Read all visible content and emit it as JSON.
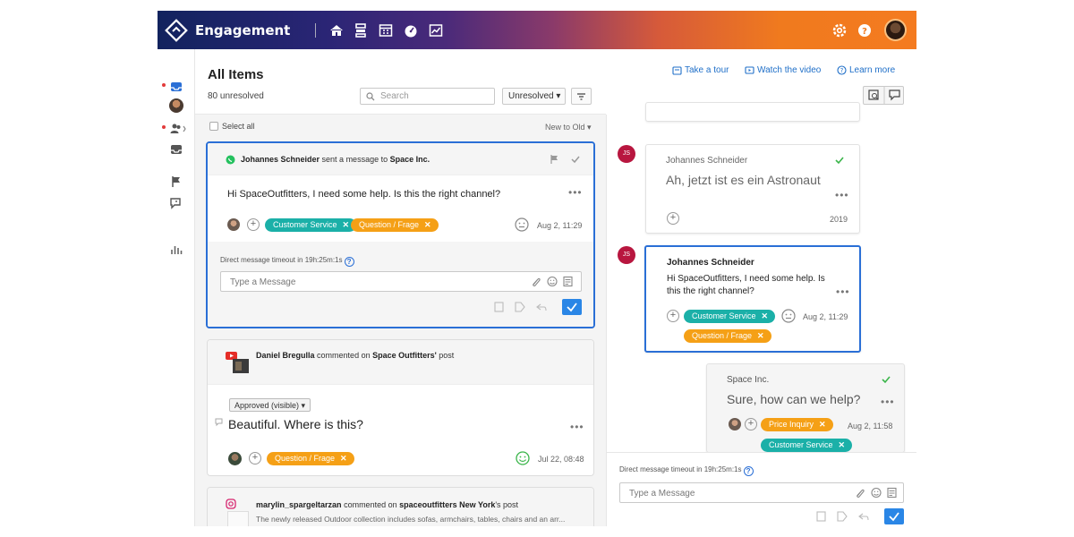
{
  "app": {
    "name": "Engagement"
  },
  "header": {
    "title": "All Items",
    "unresolved_count": "80 unresolved",
    "search_placeholder": "Search",
    "status_filter": "Unresolved",
    "links": {
      "tour": "Take a tour",
      "video": "Watch the video",
      "learn": "Learn more"
    }
  },
  "list": {
    "select_all": "Select all",
    "sort": "New to Old",
    "items": [
      {
        "author": "Johannes Schneider",
        "action": "sent a message to",
        "target": "Space Inc.",
        "message": "Hi SpaceOutfitters, I need some help. Is this the right channel?",
        "tags": [
          "Customer Service",
          "Question / Frage"
        ],
        "time": "Aug 2, 11:29",
        "timeout": "Direct message timeout in 19h:25m:1s",
        "reply_placeholder": "Type a Message"
      },
      {
        "author": "Daniel Bregulla",
        "action": "commented on",
        "target": "Space Outfitters'",
        "target_suffix": "post",
        "status": "Approved (visible)",
        "message": "Beautiful. Where is this?",
        "tags": [
          "Question / Frage"
        ],
        "time": "Jul 22, 08:48"
      },
      {
        "author": "marylin_spargeltarzan",
        "action": "commented on",
        "target": "spaceoutfitters New York",
        "target_suffix": "'s post",
        "preview": "The newly released Outdoor collection includes sofas, armchairs, tables, chairs and an arr..."
      }
    ]
  },
  "conversation": {
    "messages": [
      {
        "avatar": "JS",
        "sender": "Johannes Schneider",
        "text": "Ah, jetzt ist es ein Astronaut",
        "time": "2019"
      },
      {
        "avatar": "JS",
        "sender": "Johannes Schneider",
        "text": "Hi SpaceOutfitters, I need some help. Is this the right channel?",
        "tags": [
          "Customer Service",
          "Question / Frage"
        ],
        "time": "Aug 2, 11:29"
      },
      {
        "sender": "Space Inc.",
        "text": "Sure, how can we help?",
        "tags": [
          "Price Inquiry",
          "Customer Service"
        ],
        "time": "Aug 2, 11:58"
      }
    ],
    "timeout": "Direct message timeout in 19h:25m:1s",
    "reply_placeholder": "Type a Message"
  },
  "colors": {
    "teal_tag": "#1bb0a8",
    "orange_tag": "#f5a016",
    "selection": "#2a6fd6",
    "avatar_js": "#b8163f"
  },
  "icons": [
    "logo-icon",
    "home-icon",
    "inbox-stack-icon",
    "calendar-icon",
    "dashboard-icon",
    "reports-icon",
    "settings-icon",
    "help-icon",
    "whatsapp-icon",
    "youtube-icon",
    "instagram-icon",
    "flag-icon",
    "check-icon",
    "emoji-icon",
    "attach-icon",
    "template-icon",
    "send-icon"
  ]
}
